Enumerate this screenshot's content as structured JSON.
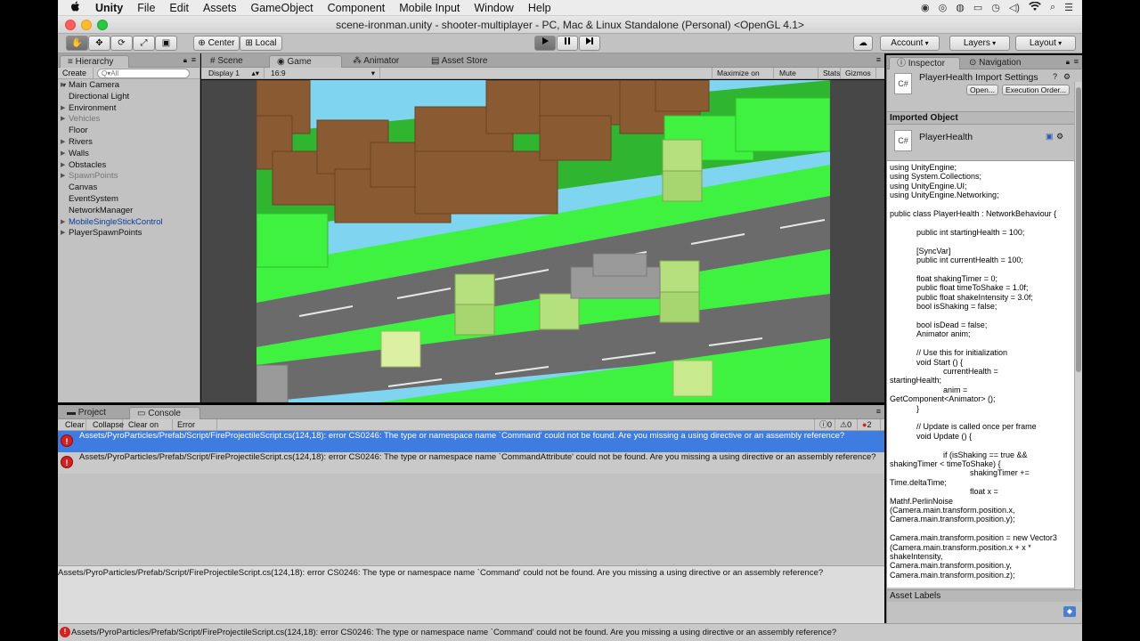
{
  "menubar": {
    "apple": "",
    "app_name": "Unity",
    "items": [
      "File",
      "Edit",
      "Assets",
      "GameObject",
      "Component",
      "Mobile Input",
      "Window",
      "Help"
    ]
  },
  "window": {
    "title": "scene-ironman.unity - shooter-multiplayer - PC, Mac & Linux Standalone (Personal) <OpenGL 4.1>"
  },
  "toolbar": {
    "pivot_label": "Center",
    "space_label": "Local",
    "account_label": "Account",
    "layers_label": "Layers",
    "layout_label": "Layout"
  },
  "hierarchy": {
    "tab_label": "Hierarchy",
    "create_label": "Create",
    "search_placeholder": "Q▾All",
    "items": [
      {
        "label": "Main Camera",
        "arrow": "▶"
      },
      {
        "label": "Directional Light",
        "arrow": ""
      },
      {
        "label": "Environment",
        "arrow": "▶"
      },
      {
        "label": "Vehicles",
        "arrow": "▶"
      },
      {
        "label": "Floor",
        "arrow": ""
      },
      {
        "label": "Rivers",
        "arrow": "▶"
      },
      {
        "label": "Walls",
        "arrow": "▶"
      },
      {
        "label": "Obstacles",
        "arrow": "▶"
      },
      {
        "label": "SpawnPoints",
        "arrow": "▶"
      },
      {
        "label": "Canvas",
        "arrow": ""
      },
      {
        "label": "EventSystem",
        "arrow": ""
      },
      {
        "label": "NetworkManager",
        "arrow": ""
      },
      {
        "label": "MobileSingleStickControl",
        "arrow": "▶"
      },
      {
        "label": "PlayerSpawnPoints",
        "arrow": "▶"
      }
    ]
  },
  "center_tabs": {
    "scene": "Scene",
    "game": "Game",
    "animator": "Animator",
    "asset_store": "Asset Store"
  },
  "game_bar": {
    "display": "Display 1",
    "aspect": "16:9",
    "maximize": "Maximize on Play",
    "mute": "Mute audio",
    "stats": "Stats",
    "gizmos": "Gizmos"
  },
  "console": {
    "project_tab": "Project",
    "console_tab": "Console",
    "clear": "Clear",
    "collapse": "Collapse",
    "clear_on_play": "Clear on Play",
    "error_pause": "Error Pause",
    "info_count": "0",
    "warning_count": "0",
    "error_count": "2",
    "entries": [
      "Assets/PyroParticles/Prefab/Script/FireProjectileScript.cs(124,18): error CS0246: The type or namespace name `Command' could not be found. Are you missing a using directive or an assembly reference?",
      "Assets/PyroParticles/Prefab/Script/FireProjectileScript.cs(124,18): error CS0246: The type or namespace name `CommandAttribute' could not be found. Are you missing a using directive or an assembly reference?"
    ],
    "detail": "Assets/PyroParticles/Prefab/Script/FireProjectileScript.cs(124,18): error CS0246: The type or namespace name `Command' could not be found. Are you missing a using directive or an assembly reference?"
  },
  "inspector": {
    "tab_label": "Inspector",
    "nav_tab_label": "Navigation",
    "import_title": "PlayerHealth Import Settings",
    "open_label": "Open...",
    "exec_order_label": "Execution Order...",
    "imported_object": "Imported Object",
    "object_name": "PlayerHealth",
    "code": "using UnityEngine;\nusing System.Collections;\nusing UnityEngine.UI;\nusing UnityEngine.Networking;\n\npublic class PlayerHealth : NetworkBehaviour {\n\n            public int startingHealth = 100;\n\n            [SyncVar]\n            public int currentHealth = 100;\n\n            float shakingTimer = 0;\n            public float timeToShake = 1.0f;\n            public float shakeIntensity = 3.0f;\n            bool isShaking = false;\n\n            bool isDead = false;\n            Animator anim;\n\n            // Use this for initialization\n            void Start () {\n                        currentHealth =\nstartingHealth;\n                        anim =\nGetComponent<Animator> ();\n            }\n\n            // Update is called once per frame\n            void Update () {\n\n                        if (isShaking == true &&\nshakingTimer < timeToShake) {\n                                    shakingTimer +=\nTime.deltaTime;\n                                    float x =\nMathf.PerlinNoise\n(Camera.main.transform.position.x,\nCamera.main.transform.position.y);\n\nCamera.main.transform.position = new Vector3\n(Camera.main.transform.position.x + x *\nshakeIntensity,\nCamera.main.transform.position.y,\nCamera.main.transform.position.z);",
    "asset_labels": "Asset Labels"
  },
  "status_bar": {
    "message": "Assets/PyroParticles/Prefab/Script/FireProjectileScript.cs(124,18): error CS0246: The type or namespace name `Command' could not be found. Are you missing a using directive or an assembly reference?"
  },
  "colors": {
    "grass": "#3ff23f",
    "road": "#6b6b6b",
    "water": "#7fd4f0",
    "trunk": "#8a5a32",
    "selection": "#3e7ce0",
    "error": "#d42020"
  }
}
